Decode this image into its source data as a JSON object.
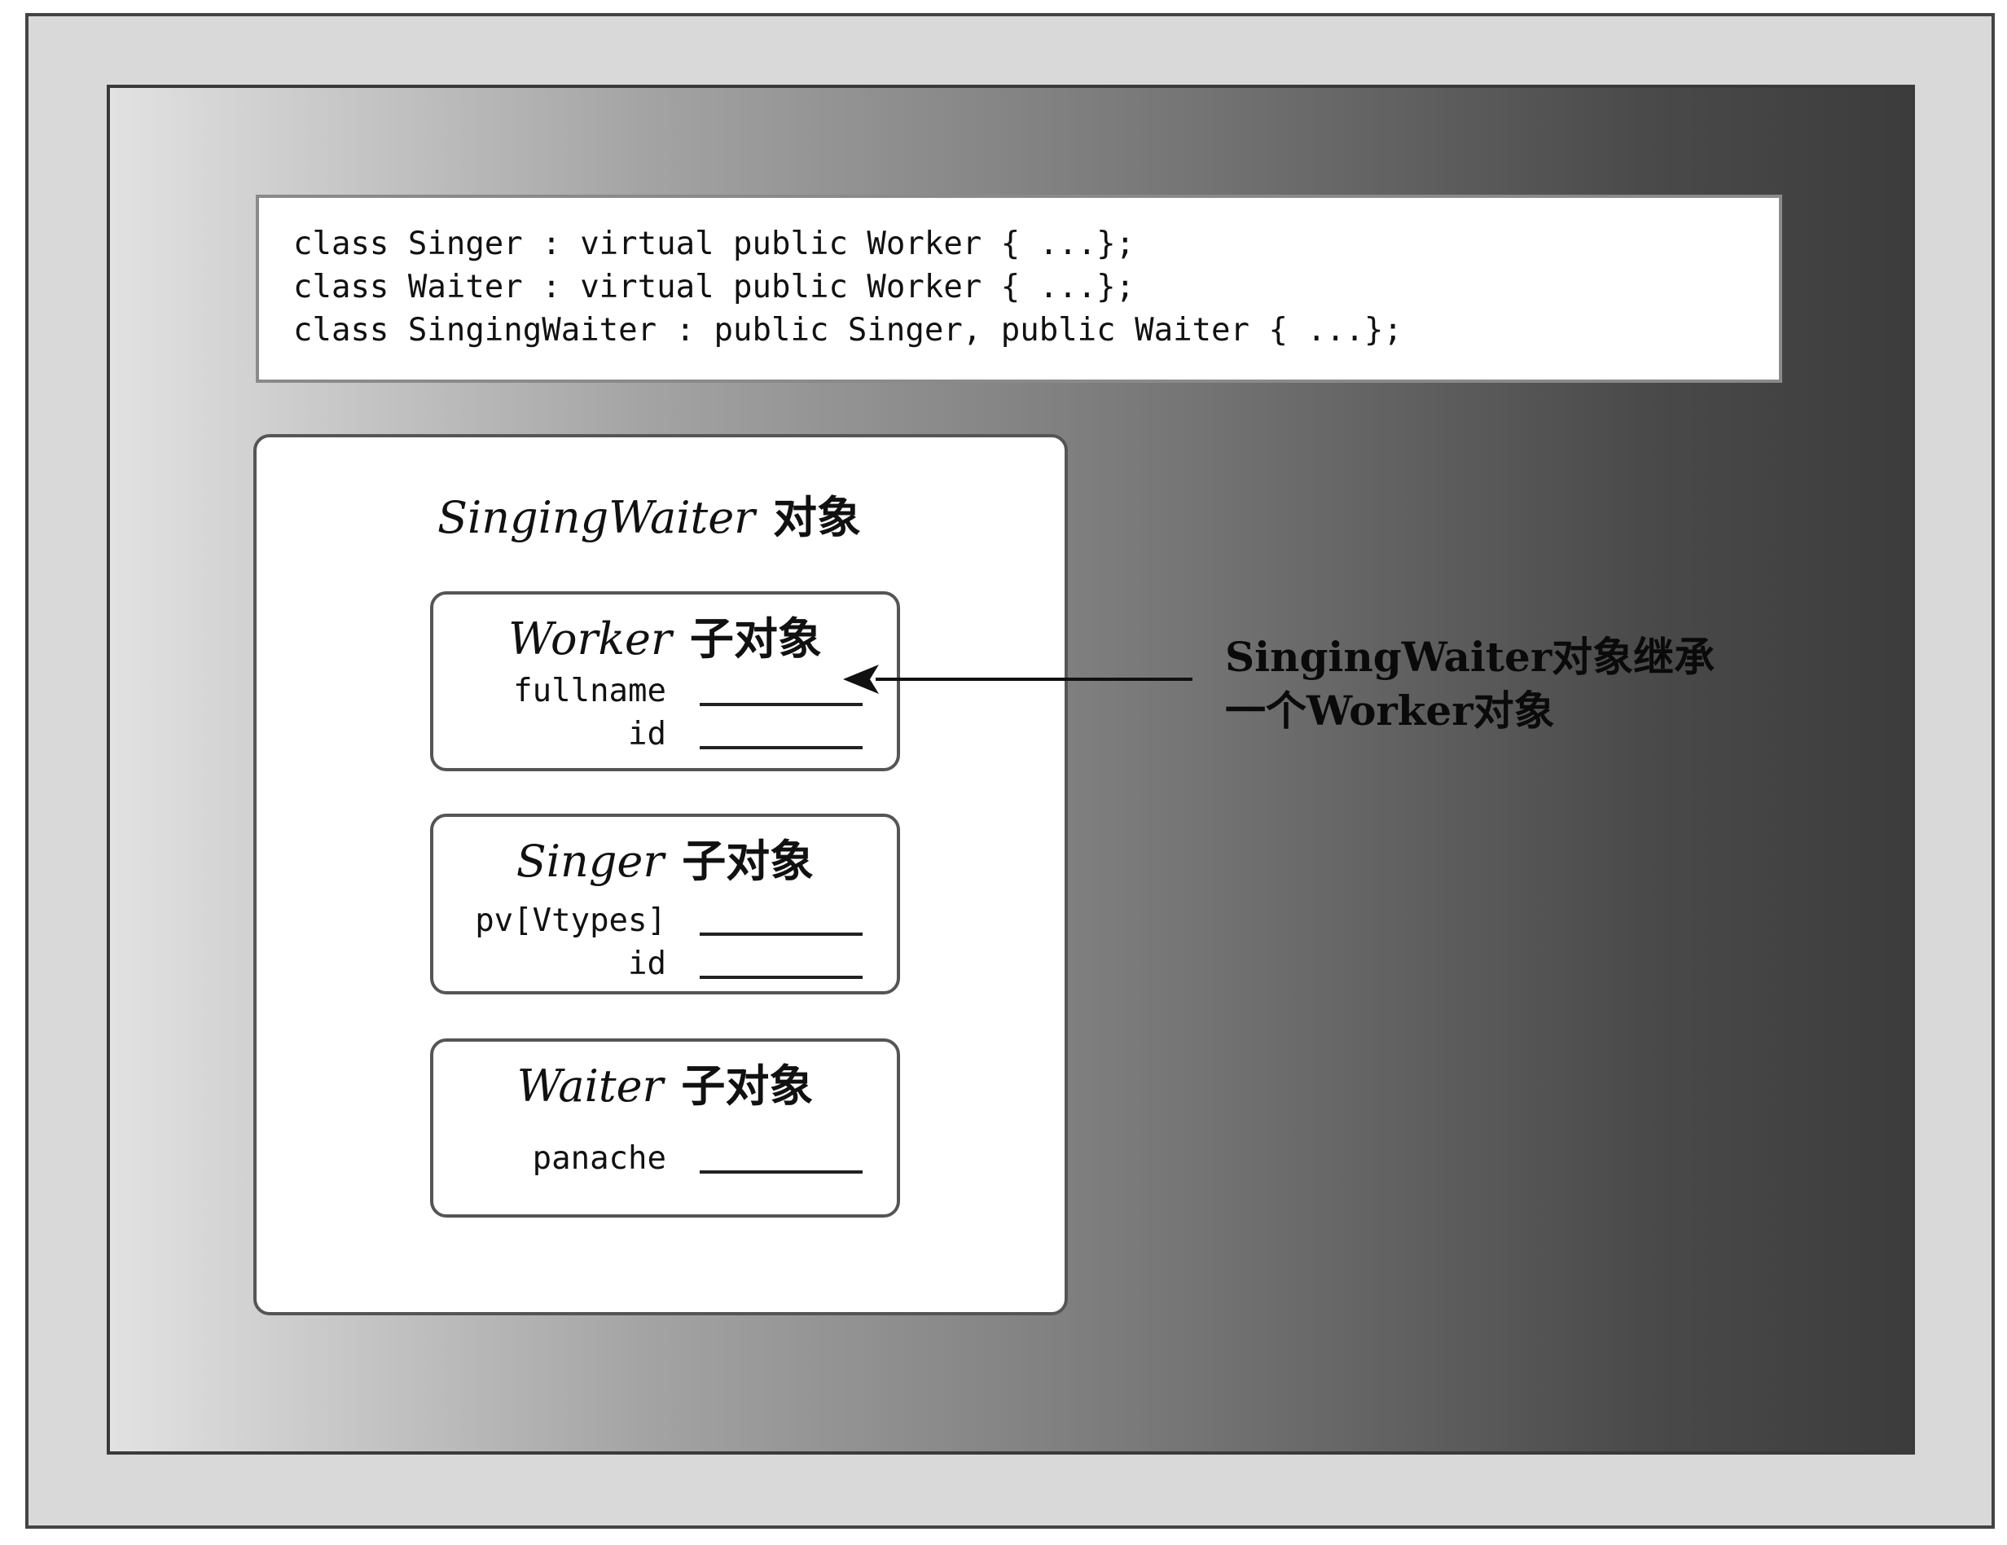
{
  "code": {
    "lines": [
      "class Singer : virtual public Worker { ...};",
      "class Waiter : virtual public Worker { ...};",
      "class SingingWaiter : public Singer, public Waiter { ...};"
    ]
  },
  "object": {
    "class_name": "SingingWaiter",
    "suffix": "对象"
  },
  "subobjects": {
    "worker": {
      "class_name": "Worker",
      "suffix": "子对象",
      "fields": [
        "fullname",
        "id"
      ]
    },
    "singer": {
      "class_name": "Singer",
      "suffix": "子对象",
      "fields": [
        "pv[Vtypes]",
        "id"
      ]
    },
    "waiter": {
      "class_name": "Waiter",
      "suffix": "子对象",
      "fields": [
        "panache"
      ]
    }
  },
  "annotation": {
    "lines": [
      "SingingWaiter对象继承",
      "一个Worker对象"
    ]
  }
}
